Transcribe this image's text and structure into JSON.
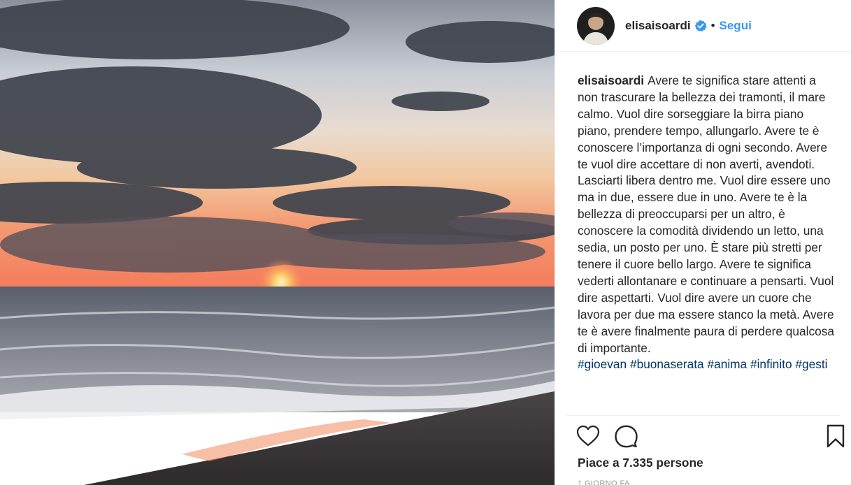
{
  "post": {
    "username": "elisaisoardi",
    "follow_label": "Segui",
    "separator": "•",
    "caption_author": "elisaisoardi",
    "caption_text": "Avere te significa stare attenti a non trascurare la bellezza dei tramonti, il mare calmo. Vuol dire sorseggiare la birra piano piano, prendere tempo, allungarlo. Avere te è conoscere l’importanza di ogni secondo. Avere te vuol dire accettare di non averti, avendoti. Lasciarti libera dentro me. Vuol dire essere uno ma in due, essere due in uno. Avere te è la bellezza di preoccuparsi per un altro, è conoscere la comodità dividendo un letto, una sedia, un posto per uno. È stare più stretti per tenere il cuore bello largo. Avere te significa vederti allontanare e continuare a pensarti. Vuol dire aspettarti. Vuol dire avere un cuore che lavora per due ma essere stanco la metà. Avere te è avere finalmente paura di perdere qualcosa di importante.",
    "hashtags": [
      "#gioevan",
      "#buonaserata",
      "#anima",
      "#infinito",
      "#gesti"
    ],
    "likes_text": "Piace a 7.335 persone",
    "timestamp": "1 GIORNO FA"
  },
  "icons": {
    "verified": "verified-badge-icon",
    "like": "heart-icon",
    "comment": "comment-bubble-icon",
    "save": "bookmark-icon"
  },
  "colors": {
    "follow": "#3897f0",
    "verified": "#3897f0",
    "hashtag": "#003569",
    "text": "#262626",
    "muted": "#999999"
  }
}
